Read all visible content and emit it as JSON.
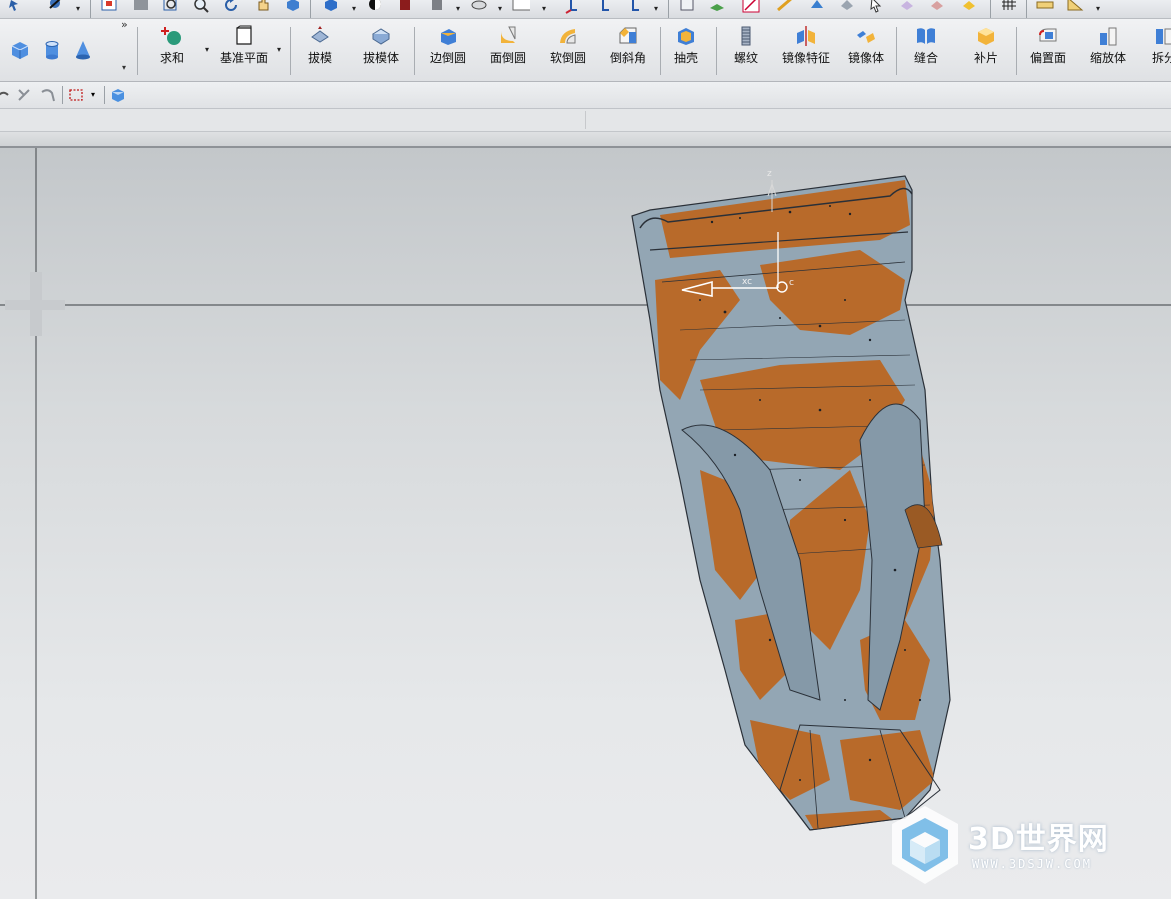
{
  "toolbar_features": {
    "primitives": [
      {
        "icon": "block-icon"
      },
      {
        "icon": "cylinder-icon"
      },
      {
        "icon": "cone-icon"
      }
    ],
    "more_glyph": "»",
    "buttons": [
      {
        "id": "unite",
        "label": "求和",
        "icon": "unite-icon",
        "dropdown": true
      },
      {
        "id": "datum-plane",
        "label": "基准平面",
        "icon": "datum-plane-icon",
        "dropdown": true
      },
      {
        "id": "draft",
        "label": "拔模",
        "icon": "draft-icon"
      },
      {
        "id": "draft-body",
        "label": "拔模体",
        "icon": "draft-body-icon"
      },
      {
        "id": "edge-blend",
        "label": "边倒圆",
        "icon": "edge-blend-icon"
      },
      {
        "id": "face-blend",
        "label": "面倒圆",
        "icon": "face-blend-icon"
      },
      {
        "id": "soft-blend",
        "label": "软倒圆",
        "icon": "soft-blend-icon"
      },
      {
        "id": "chamfer",
        "label": "倒斜角",
        "icon": "chamfer-icon"
      },
      {
        "id": "shell",
        "label": "抽壳",
        "icon": "shell-icon"
      },
      {
        "id": "thread",
        "label": "螺纹",
        "icon": "thread-icon"
      },
      {
        "id": "mirror-feature",
        "label": "镜像特征",
        "icon": "mirror-feature-icon"
      },
      {
        "id": "mirror-body",
        "label": "镜像体",
        "icon": "mirror-body-icon"
      },
      {
        "id": "sew",
        "label": "缝合",
        "icon": "sew-icon"
      },
      {
        "id": "patch",
        "label": "补片",
        "icon": "patch-icon"
      },
      {
        "id": "offset-face",
        "label": "偏置面",
        "icon": "offset-face-icon"
      },
      {
        "id": "scale-body",
        "label": "缩放体",
        "icon": "scale-body-icon"
      },
      {
        "id": "split",
        "label": "拆分",
        "icon": "split-body-icon"
      }
    ]
  },
  "viewport": {
    "csys_labels": {
      "z": "z",
      "x": "xc",
      "origin": "c"
    },
    "model_colors": {
      "body": "#93a6b4",
      "scan": "#b86a2a",
      "edge": "#2a3038"
    }
  },
  "watermark": {
    "title": "3D世界网",
    "url": "WWW.3DSJW.COM"
  }
}
